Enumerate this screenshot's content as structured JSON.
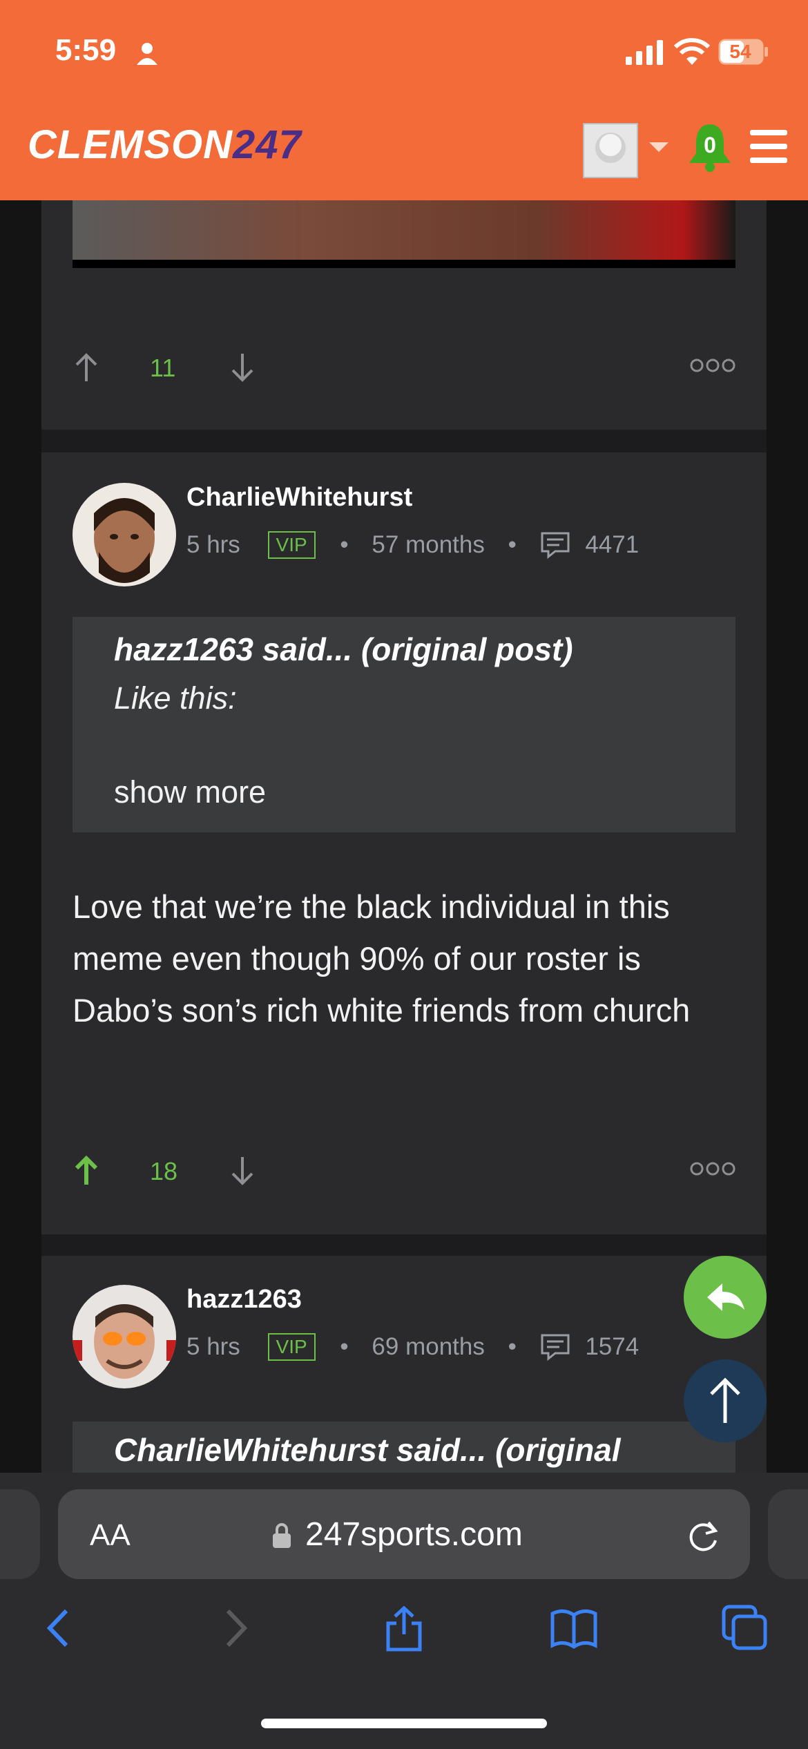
{
  "status_bar": {
    "time": "5:59",
    "battery": "54"
  },
  "header": {
    "logo_text": "CLEMSON",
    "logo_num": "247",
    "notification_count": "0"
  },
  "posts": [
    {
      "upvotes": "11"
    },
    {
      "username": "CharlieWhitehurst",
      "time": "5 hrs",
      "badge": "VIP",
      "tenure": "57 months",
      "post_count": "4471",
      "quote_head": "hazz1263 said... (original post)",
      "quote_body": "Like this:",
      "show_more": "show more",
      "body": "Love that we’re the black individual in this meme even though 90% of our roster is Dabo’s son’s rich white friends from church",
      "upvotes": "18"
    },
    {
      "username": "hazz1263",
      "time": "5 hrs",
      "badge": "VIP",
      "tenure": "69 months",
      "post_count": "1574",
      "quote_head": "CharlieWhitehurst said... (original"
    }
  ],
  "browser": {
    "text_size": "AA",
    "url": "247sports.com"
  },
  "colors": {
    "brand_orange": "#f26b38",
    "accent_green": "#6cc04a",
    "card": "#2a2a2c"
  }
}
